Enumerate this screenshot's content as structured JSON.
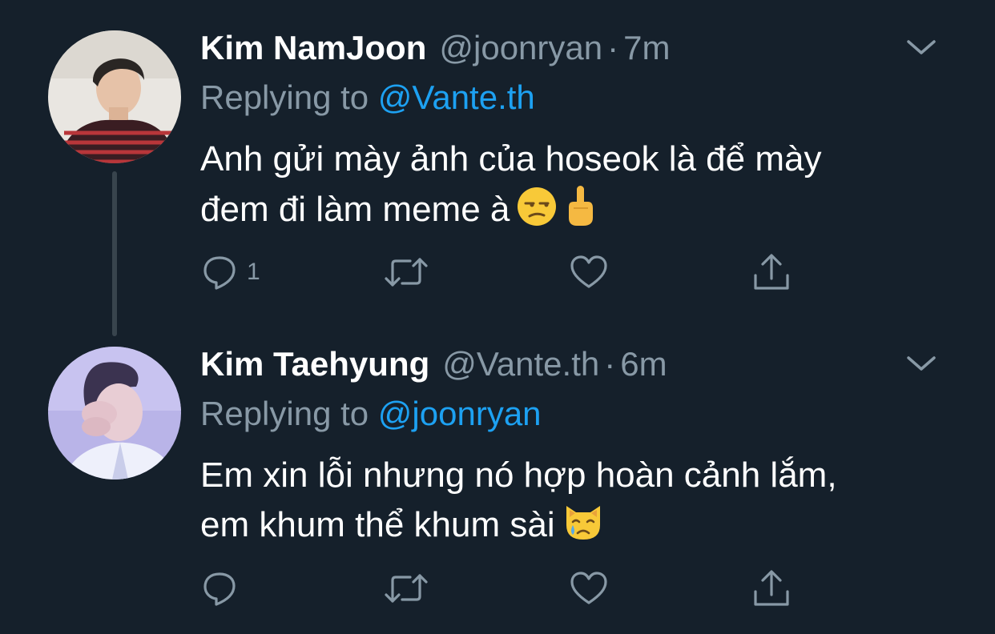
{
  "tweets": [
    {
      "display_name": "Kim NamJoon",
      "handle": "@joonryan",
      "separator": "·",
      "time": "7m",
      "replying_prefix": "Replying to",
      "replying_to": "@Vante.th",
      "body_line_1": "Anh gửi mày ảnh của hoseok là để mày",
      "body_line_2": "đem đi làm meme à",
      "emojis": [
        "unamused-face",
        "middle-finger"
      ],
      "reply_count": "1",
      "avatar_icon": "avatar-striped-shirt"
    },
    {
      "display_name": "Kim Taehyung",
      "handle": "@Vante.th",
      "separator": "·",
      "time": "6m",
      "replying_prefix": "Replying to",
      "replying_to": "@joonryan",
      "body_line_1": "Em xin lỗi nhưng nó hợp hoàn cảnh lắm,",
      "body_line_2": "em khum thể khum sài",
      "emojis": [
        "crying-cat-face"
      ],
      "reply_count": "",
      "avatar_icon": "avatar-lavender"
    }
  ],
  "colors": {
    "background": "#15202b",
    "text_primary": "#ffffff",
    "text_secondary": "#8899a6",
    "accent": "#1da1f2",
    "thread_line": "#38444d"
  },
  "icons": {
    "reply": "reply-bubble-icon",
    "retweet": "retweet-icon",
    "like": "heart-icon",
    "share": "share-icon",
    "more": "chevron-down-icon"
  }
}
